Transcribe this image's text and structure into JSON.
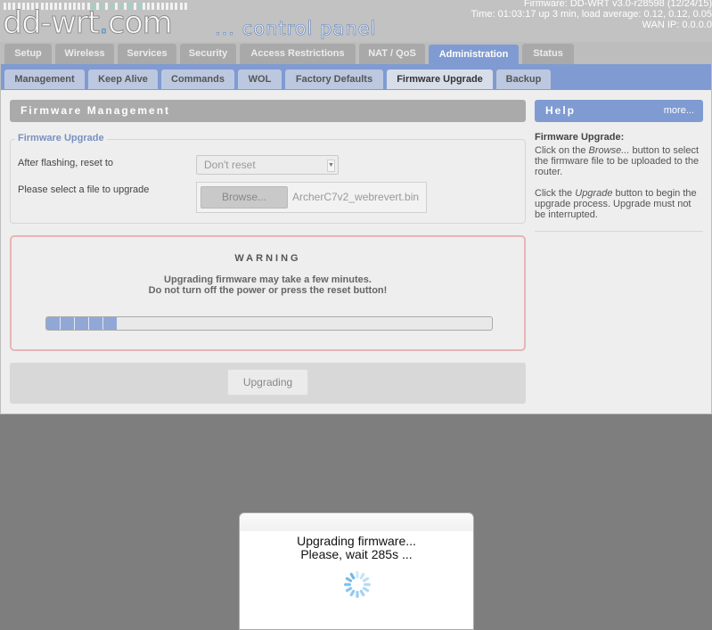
{
  "header": {
    "logo_text": "dd-wrt",
    "logo_dot": ".",
    "logo_com": "com",
    "logo_subtitle": "... control panel",
    "firmware": "Firmware: DD-WRT v3.0-r28598 (12/24/15)",
    "time": "Time: 01:03:17 up 3 min, load average: 0.12, 0.12, 0.05",
    "wan_ip": "WAN IP: 0.0.0.0"
  },
  "main_tabs": [
    {
      "label": "Setup",
      "active": false
    },
    {
      "label": "Wireless",
      "active": false
    },
    {
      "label": "Services",
      "active": false
    },
    {
      "label": "Security",
      "active": false
    },
    {
      "label": "Access Restrictions",
      "active": false
    },
    {
      "label": "NAT / QoS",
      "active": false
    },
    {
      "label": "Administration",
      "active": true
    },
    {
      "label": "Status",
      "active": false
    }
  ],
  "sub_tabs": [
    {
      "label": "Management",
      "active": false
    },
    {
      "label": "Keep Alive",
      "active": false
    },
    {
      "label": "Commands",
      "active": false
    },
    {
      "label": "WOL",
      "active": false
    },
    {
      "label": "Factory Defaults",
      "active": false
    },
    {
      "label": "Firmware Upgrade",
      "active": true
    },
    {
      "label": "Backup",
      "active": false
    }
  ],
  "section_title": "Firmware Management",
  "firmware_upgrade": {
    "legend": "Firmware Upgrade",
    "reset_label": "After flashing, reset to",
    "reset_value": "Don't reset",
    "file_label": "Please select a file to upgrade",
    "browse_label": "Browse...",
    "file_name": "ArcherC7v2_webrevert.bin"
  },
  "warning": {
    "title": "WARNING",
    "line1": "Upgrading firmware may take a few minutes.",
    "line2": "Do not turn off the power or press the reset button!",
    "progress_percent": 16
  },
  "upgrade_button": "Upgrading",
  "help": {
    "title": "Help",
    "more": "more...",
    "heading": "Firmware Upgrade:",
    "p1_a": "Click on the ",
    "p1_em": "Browse...",
    "p1_b": " button to select the firmware file to be uploaded to the router.",
    "p2_a": "Click the ",
    "p2_em": "Upgrade",
    "p2_b": " button to begin the upgrade process. Upgrade must not be interrupted."
  },
  "dialog": {
    "line1": "Upgrading firmware...",
    "line2": "Please, wait 285s ..."
  },
  "colors": {
    "accent_blue": "#7f9bd2",
    "section_gray": "#aaaaaa",
    "warning_border": "#e5b6b6",
    "progress_fill": "#91a7d6"
  }
}
